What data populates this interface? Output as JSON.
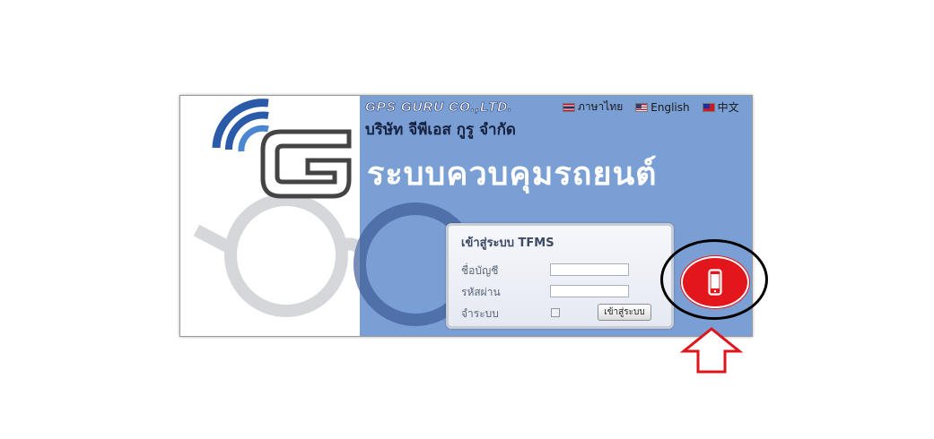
{
  "header": {
    "company_name_en": "GPS GURU CO.,LTD.",
    "company_name_th": "บริษัท จีพีเอส กูรู จำกัด",
    "system_title": "ระบบควบคุมรถยนต์"
  },
  "languages": [
    {
      "label": "ภาษาไทย",
      "flag": "flag-thailand-icon"
    },
    {
      "label": "English",
      "flag": "flag-usa-icon"
    },
    {
      "label": "中文",
      "flag": "flag-taiwan-icon"
    }
  ],
  "login": {
    "title": "เข้าสู่ระบบ TFMS",
    "username_label": "ชื่อบัญชี",
    "username_value": "",
    "password_label": "รหัสผ่าน",
    "password_value": "",
    "remember_label": "จำระบบ",
    "remember_checked": false,
    "button_label": "เข้าสู่ระบบ"
  },
  "mobile": {
    "icon": "mobile-phone-icon",
    "color": "#e3161b"
  },
  "colors": {
    "panel_blue": "#7a9fd4",
    "logo_blue": "#2a5aa8",
    "logo_gray": "#444444"
  }
}
